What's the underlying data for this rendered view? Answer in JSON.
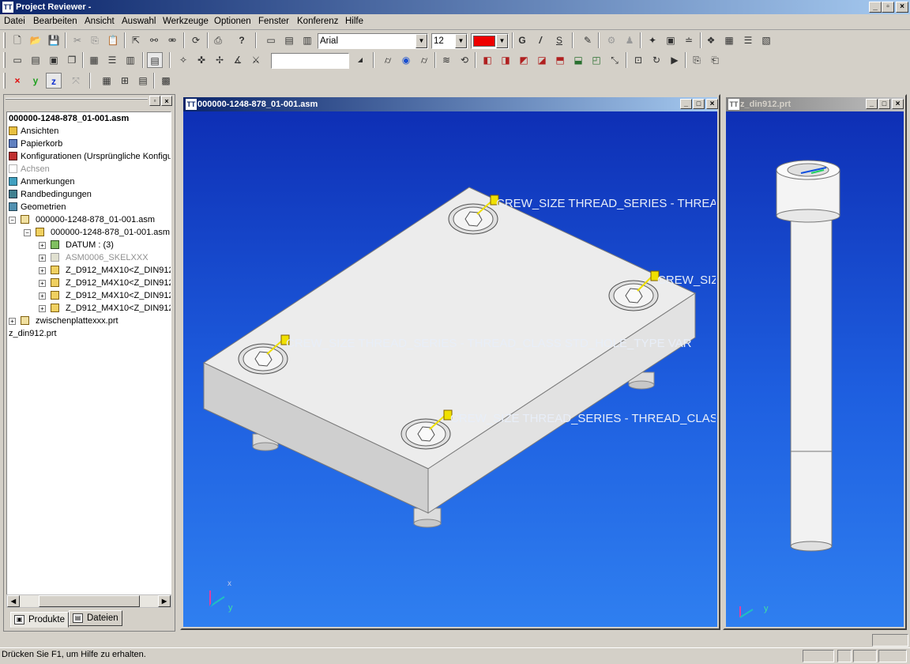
{
  "app": {
    "title": "Project Reviewer -"
  },
  "menu": [
    "Datei",
    "Bearbeiten",
    "Ansicht",
    "Auswahl",
    "Werkzeuge",
    "Optionen",
    "Fenster",
    "Konferenz",
    "Hilfe"
  ],
  "toolbar": {
    "font_name": "Arial",
    "font_size": "12",
    "font_color": "#ee0000",
    "bold_label": "G",
    "italic_label": "/",
    "underline_label": "S",
    "search_value": ""
  },
  "axis_buttons": {
    "x": "x",
    "y": "y",
    "z": "z"
  },
  "tree": {
    "root": "000000-1248-878_01-001.asm",
    "items": [
      {
        "label": "Ansichten"
      },
      {
        "label": "Papierkorb"
      },
      {
        "label": "Konfigurationen (Ursprüngliche Konfigu"
      },
      {
        "label": "Achsen"
      },
      {
        "label": "Anmerkungen"
      },
      {
        "label": "Randbedingungen"
      },
      {
        "label": "Geometrien"
      },
      {
        "label": "000000-1248-878_01-001.asm"
      },
      {
        "label": "000000-1248-878_01-001.asm"
      },
      {
        "label": "DATUM : (3)"
      },
      {
        "label": "ASM0006_SKELXXX"
      },
      {
        "label": "Z_D912_M4X10<Z_DIN912"
      },
      {
        "label": "Z_D912_M4X10<Z_DIN912"
      },
      {
        "label": "Z_D912_M4X10<Z_DIN912"
      },
      {
        "label": "Z_D912_M4X10<Z_DIN912"
      },
      {
        "label": "zwischenplattexxx.prt"
      },
      {
        "label": "z_din912.prt"
      }
    ]
  },
  "tabs": {
    "products": "Produkte",
    "files": "Dateien"
  },
  "windows": {
    "main": {
      "title": "000000-1248-878_01-001.asm"
    },
    "part": {
      "title": "z_din912.prt"
    }
  },
  "annotations": {
    "a1": "CREW_SIZE THREAD_SERIES - THREAD_CLASS STD_HOLE_TYPE VAR",
    "a2": "CREW_SIZE THREAD_SERIES - THREAD_CLASS STD_HOLE_TYPE VAR",
    "a3": "CREW_SIZE THREAD_SERIES - THREAD_CLASS STD_HOLE_TYPE VAR",
    "a4": "CREW_SIZE THREAD_SERIES - THREAD_CLASS STD_HOLE_TYPE VAR"
  },
  "triad": {
    "x": "x",
    "y": "y"
  },
  "status": {
    "text": "Drücken Sie F1, um Hilfe zu erhalten."
  }
}
